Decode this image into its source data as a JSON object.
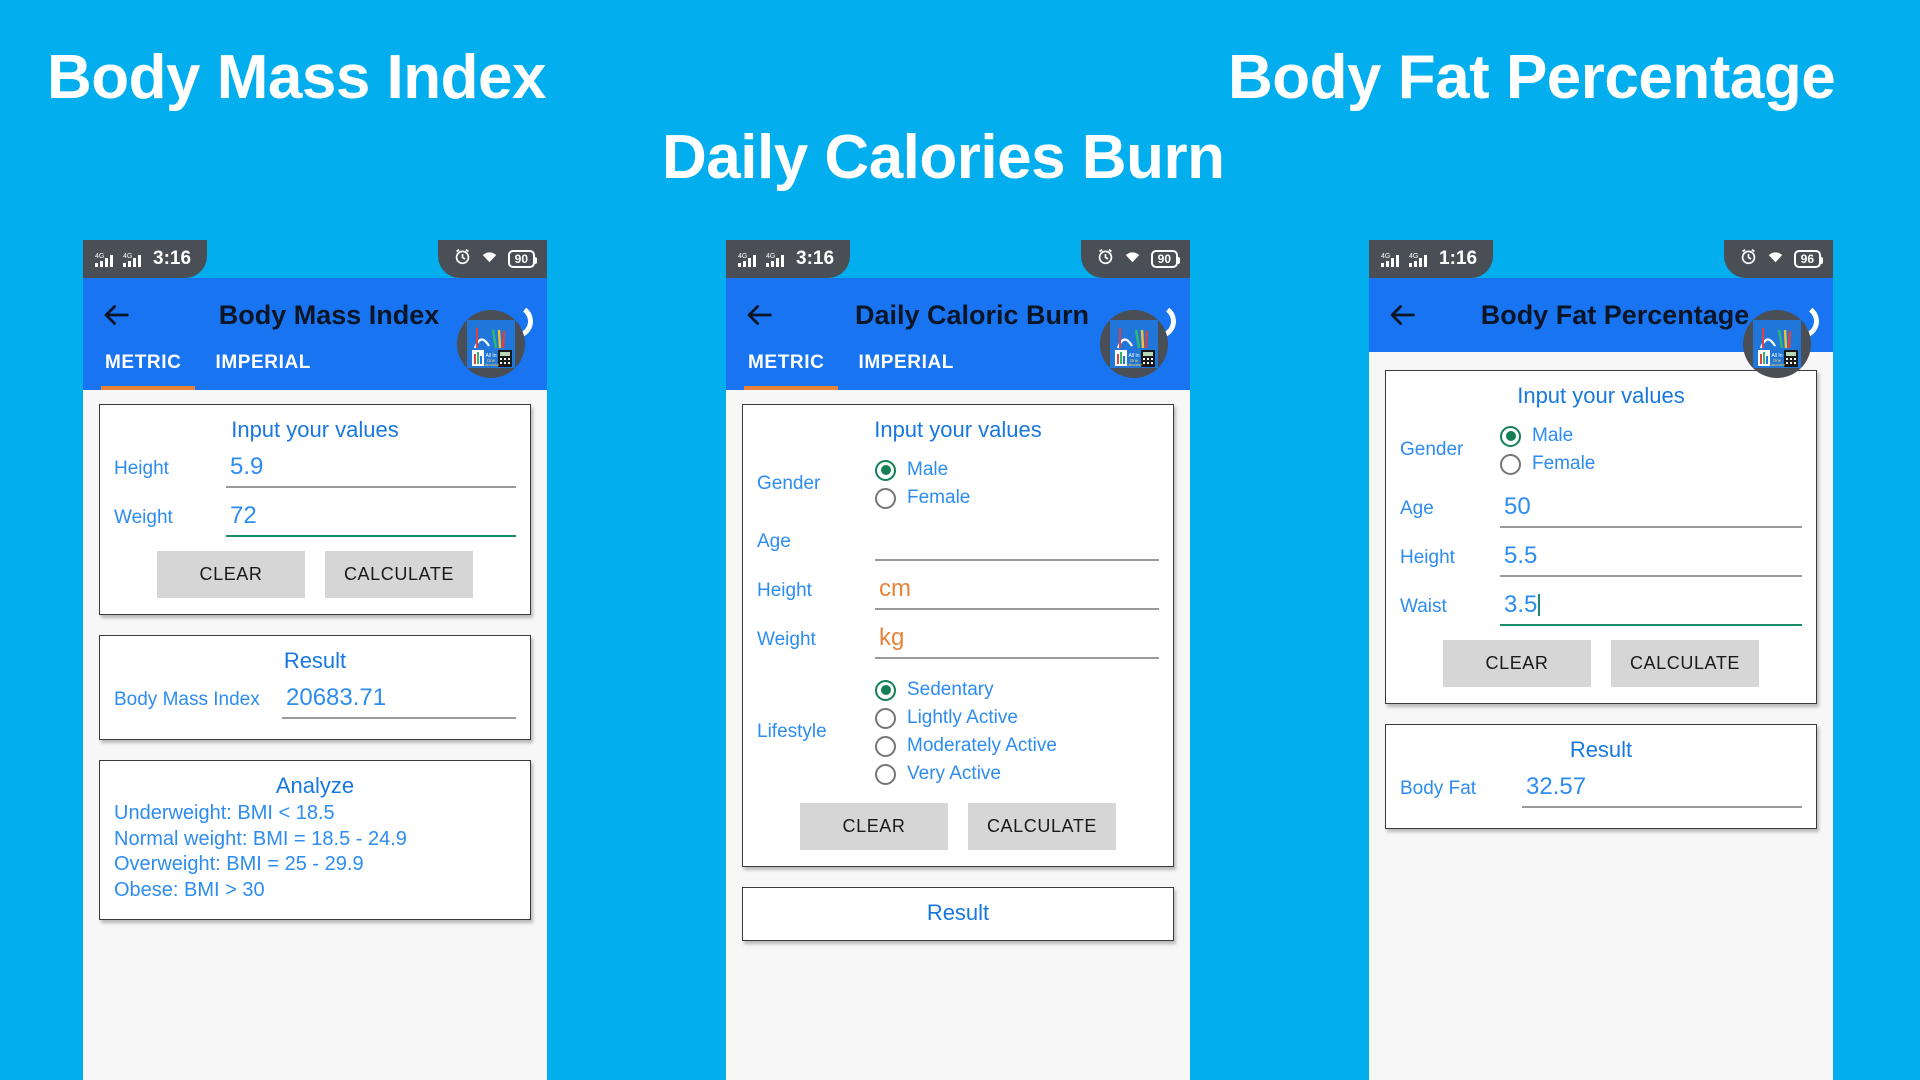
{
  "banners": {
    "bmi": "Body Mass Index",
    "fat": "Body Fat Percentage",
    "calories": "Daily Calories Burn"
  },
  "common": {
    "input_card_title": "Input your values",
    "result_card_title": "Result",
    "clear_label": "CLEAR",
    "calculate_label": "CALCULATE",
    "tab_metric": "METRIC",
    "tab_imperial": "IMPERIAL",
    "network_label": "4G",
    "app_logo_text": "All In One Calculator"
  },
  "colors": {
    "page_background": "#02AEEE",
    "appbar": "#1874F0",
    "tab_indicator": "#E8833A",
    "label_blue": "#2D8CF0",
    "focus_green": "#1B8C6B",
    "hint_orange": "#E8833A",
    "button_grey": "#D6D6D6",
    "status_notch": "#4A4F55"
  },
  "phone1": {
    "status": {
      "time": "3:16",
      "battery": "90"
    },
    "title": "Body Mass Index",
    "active_tab": "METRIC",
    "fields": [
      {
        "label": "Height",
        "value": "5.9",
        "focused": false
      },
      {
        "label": "Weight",
        "value": "72",
        "focused": true
      }
    ],
    "result": {
      "label": "Body Mass Index",
      "value": "20683.71"
    },
    "analyze": {
      "title": "Analyze",
      "lines": [
        "Underweight: BMI < 18.5",
        "Normal weight: BMI = 18.5 - 24.9",
        "Overweight: BMI = 25 - 29.9",
        "Obese: BMI > 30"
      ]
    }
  },
  "phone2": {
    "status": {
      "time": "3:16",
      "battery": "90"
    },
    "title": "Daily Caloric Burn",
    "active_tab": "METRIC",
    "gender": {
      "label": "Gender",
      "options": [
        {
          "label": "Male",
          "selected": true
        },
        {
          "label": "Female",
          "selected": false
        }
      ]
    },
    "fields": [
      {
        "label": "Age",
        "value": "",
        "hint": false
      },
      {
        "label": "Height",
        "value": "cm",
        "hint": true
      },
      {
        "label": "Weight",
        "value": "kg",
        "hint": true
      }
    ],
    "lifestyle": {
      "label": "Lifestyle",
      "options": [
        {
          "label": "Sedentary",
          "selected": true
        },
        {
          "label": "Lightly Active",
          "selected": false
        },
        {
          "label": "Moderately Active",
          "selected": false
        },
        {
          "label": "Very Active",
          "selected": false
        }
      ]
    },
    "result_peek": "Result"
  },
  "phone3": {
    "status": {
      "time": "1:16",
      "battery": "96"
    },
    "title": "Body Fat Percentage",
    "gender": {
      "label": "Gender",
      "options": [
        {
          "label": "Male",
          "selected": true
        },
        {
          "label": "Female",
          "selected": false
        }
      ]
    },
    "fields": [
      {
        "label": "Age",
        "value": "50",
        "focused": false
      },
      {
        "label": "Height",
        "value": "5.5",
        "focused": false
      },
      {
        "label": "Waist",
        "value": "3.5",
        "focused": true
      }
    ],
    "result": {
      "label": "Body Fat",
      "value": "32.57"
    }
  }
}
